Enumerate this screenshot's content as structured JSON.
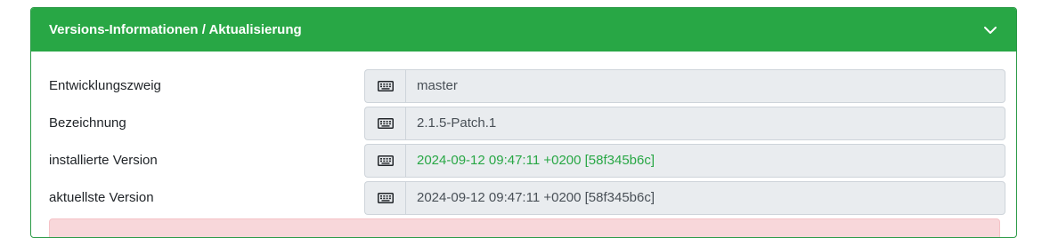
{
  "panel": {
    "title": "Versions-Informationen / Aktualisierung",
    "colors": {
      "header": "#28a745",
      "highlight_value": "#28a745",
      "alert_bg": "#f8d7da"
    }
  },
  "rows": [
    {
      "label": "Entwicklungszweig",
      "value": "master",
      "icon": "keyboard-icon"
    },
    {
      "label": "Bezeichnung",
      "value": "2.1.5-Patch.1",
      "icon": "keyboard-icon"
    },
    {
      "label": "installierte Version",
      "value": "2024-09-12 09:47:11 +0200 [58f345b6c]",
      "icon": "keyboard-icon"
    },
    {
      "label": "aktuellste Version",
      "value": "2024-09-12 09:47:11 +0200 [58f345b6c]",
      "icon": "keyboard-icon"
    }
  ]
}
